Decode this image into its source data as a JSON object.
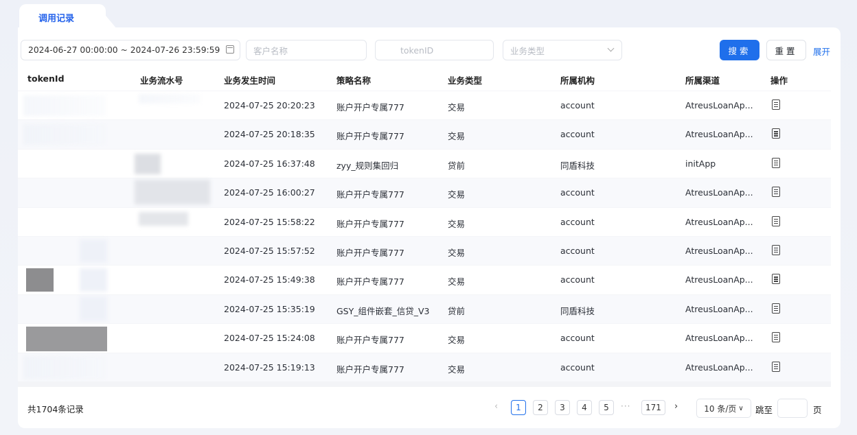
{
  "tab": {
    "label": "调用记录"
  },
  "filters": {
    "date_range": "2024-06-27 00:00:00 ~ 2024-07-26 23:59:59",
    "customer_placeholder": "客户名称",
    "token_placeholder": "tokenID",
    "biztype_placeholder": "业务类型",
    "search_label": "搜索",
    "reset_label": "重置",
    "expand_label": "展开"
  },
  "table": {
    "columns": [
      "tokenId",
      "业务流水号",
      "业务发生时间",
      "策略名称",
      "业务类型",
      "所属机构",
      "所属渠道",
      "操作"
    ],
    "rows": [
      {
        "time": "2024-07-25 20:20:23",
        "strategy": "账户开户专属777",
        "type": "交易",
        "org": "account",
        "channel": "AtreusLoanAp..."
      },
      {
        "time": "2024-07-25 20:18:35",
        "strategy": "账户开户专属777",
        "type": "交易",
        "org": "account",
        "channel": "AtreusLoanAp..."
      },
      {
        "time": "2024-07-25 16:37:48",
        "strategy": "zyy_规则集回归",
        "type": "贷前",
        "org": "同盾科技",
        "channel": "initApp"
      },
      {
        "time": "2024-07-25 16:00:27",
        "strategy": "账户开户专属777",
        "type": "交易",
        "org": "account",
        "channel": "AtreusLoanAp..."
      },
      {
        "time": "2024-07-25 15:58:22",
        "strategy": "账户开户专属777",
        "type": "交易",
        "org": "account",
        "channel": "AtreusLoanAp..."
      },
      {
        "time": "2024-07-25 15:57:52",
        "strategy": "账户开户专属777",
        "type": "交易",
        "org": "account",
        "channel": "AtreusLoanAp..."
      },
      {
        "time": "2024-07-25 15:49:38",
        "strategy": "账户开户专属777",
        "type": "交易",
        "org": "account",
        "channel": "AtreusLoanAp..."
      },
      {
        "time": "2024-07-25 15:35:19",
        "strategy": "GSY_组件嵌套_信贷_V3",
        "type": "贷前",
        "org": "同盾科技",
        "channel": "AtreusLoanAp..."
      },
      {
        "time": "2024-07-25 15:24:08",
        "strategy": "账户开户专属777",
        "type": "交易",
        "org": "account",
        "channel": "AtreusLoanAp..."
      },
      {
        "time": "2024-07-25 15:19:13",
        "strategy": "账户开户专属777",
        "type": "交易",
        "org": "account",
        "channel": "AtreusLoanAp..."
      }
    ]
  },
  "footer": {
    "total": "共1704条记录",
    "pages": [
      "1",
      "2",
      "3",
      "4",
      "5"
    ],
    "current_page": "1",
    "ellipsis": "···",
    "last_page": "171",
    "page_size": "10 条/页",
    "jump_label": "跳至",
    "page_unit": "页"
  },
  "colors": {
    "accent": "#1f6feb"
  }
}
